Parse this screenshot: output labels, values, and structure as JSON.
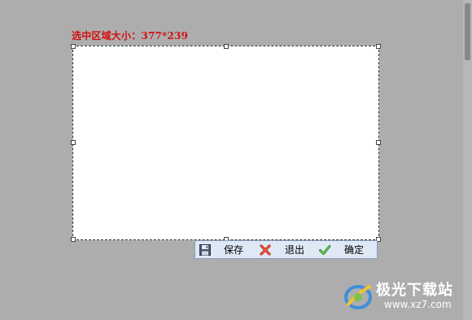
{
  "capture": {
    "size_label": "选中区域大小：377*239"
  },
  "toolbar": {
    "save_label": "保存",
    "exit_label": "退出",
    "confirm_label": "确定",
    "save_icon": "floppy-disk-icon",
    "exit_icon": "red-x-icon",
    "confirm_icon": "green-check-icon"
  },
  "watermark": {
    "title": "极光下载站",
    "url": "www.xz7.com"
  },
  "colors": {
    "overlay": "#adadad",
    "label_red": "#d21010",
    "toolbar_bg": "#dfe8f5"
  }
}
